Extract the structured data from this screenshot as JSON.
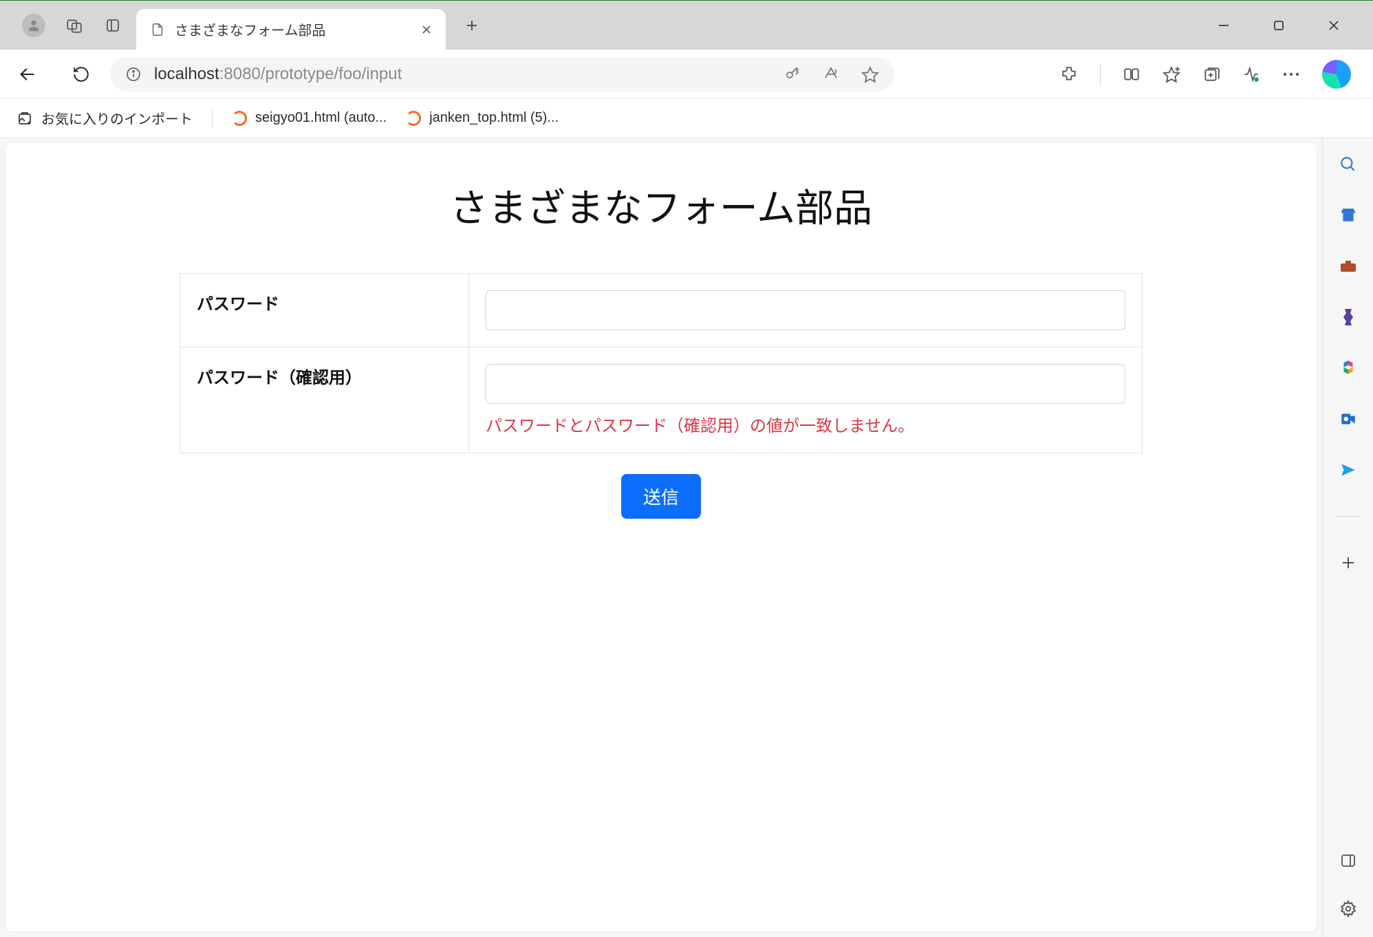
{
  "browser": {
    "tab_title": "さまざまなフォーム部品",
    "url_host": "localhost",
    "url_port": ":8080",
    "url_path": "/prototype/foo/input",
    "bookmarks_import_label": "お気に入りのインポート",
    "bookmark_items": [
      {
        "label": "seigyo01.html (auto..."
      },
      {
        "label": "janken_top.html (5)..."
      }
    ]
  },
  "page": {
    "title": "さまざまなフォーム部品",
    "rows": [
      {
        "label": "パスワード",
        "value": "",
        "error": ""
      },
      {
        "label": "パスワード（確認用）",
        "value": "",
        "error": "パスワードとパスワード（確認用）の値が一致しません。"
      }
    ],
    "submit_label": "送信"
  }
}
